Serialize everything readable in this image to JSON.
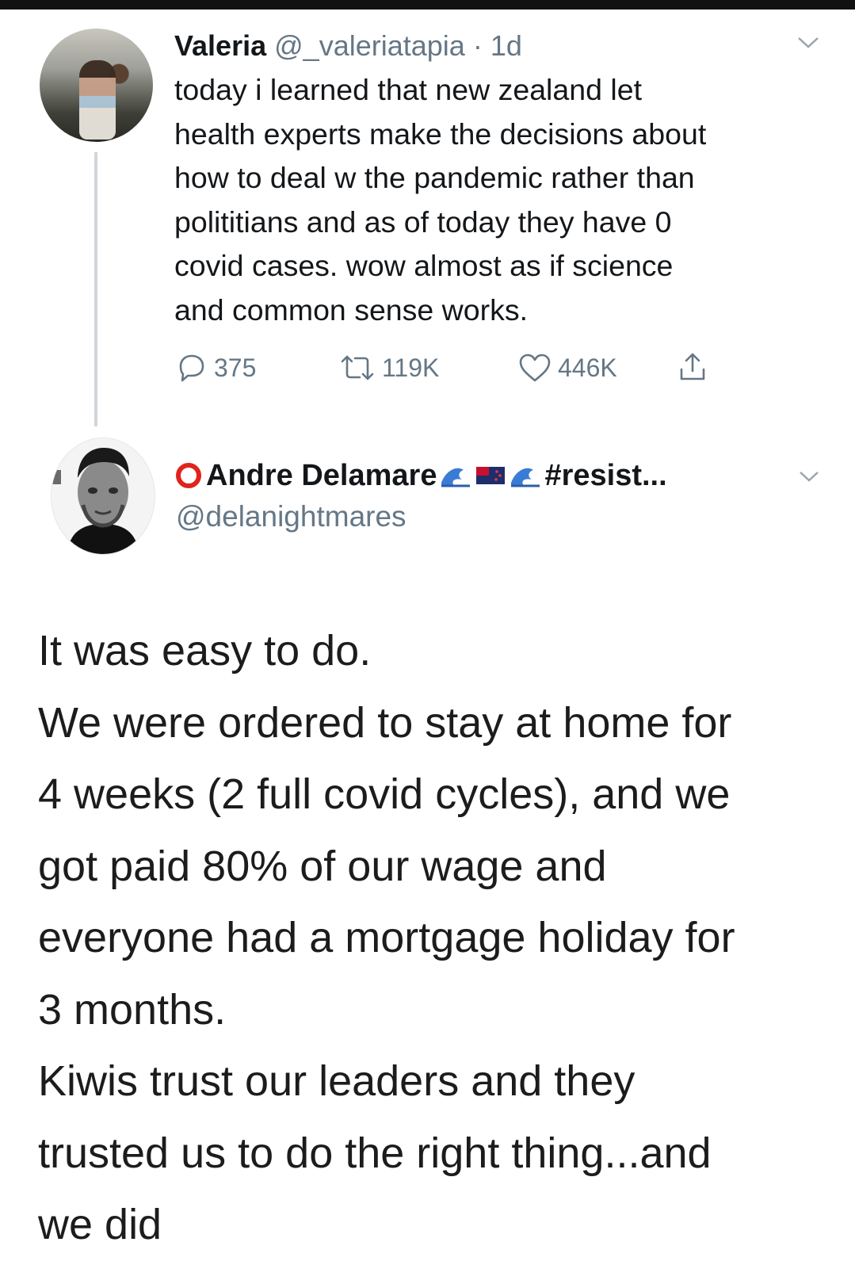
{
  "tweet1": {
    "display_name": "Valeria",
    "handle": "@_valeriatapia",
    "separator": "·",
    "time": "1d",
    "text_lines": [
      "today i learned that new zealand let",
      "health experts make the decisions about",
      "how to deal w the pandemic rather than",
      "polititians and as of today they have 0",
      "covid cases. wow almost as if science",
      "and common sense works."
    ],
    "actions": {
      "reply_count": "375",
      "retweet_count": "119K",
      "like_count": "446K"
    },
    "icons": [
      "avatar",
      "chevron-down-icon",
      "reply-icon",
      "retweet-icon",
      "like-icon",
      "share-icon"
    ]
  },
  "tweet2": {
    "display_name": "Andre Delamare",
    "name_suffix": "#resist...",
    "handle": "@delanightmares",
    "body_lines": [
      "It was easy to do.",
      "We were ordered to stay at home for",
      "4 weeks (2 full covid cycles), and we",
      "got paid 80% of our wage and",
      "everyone had a mortgage holiday for",
      "3 months.",
      "Kiwis trust our leaders and they",
      "trusted us to do the right thing...and",
      "we did"
    ],
    "icons": [
      "red-ring-icon",
      "wave-emoji-icon",
      "nz-flag-emoji-icon",
      "wave-emoji-icon",
      "chevron-down-icon"
    ]
  },
  "colors": {
    "text": "#14171a",
    "secondary": "#657786",
    "thread_line": "#cfd6dc",
    "ring": "#e0241c"
  }
}
